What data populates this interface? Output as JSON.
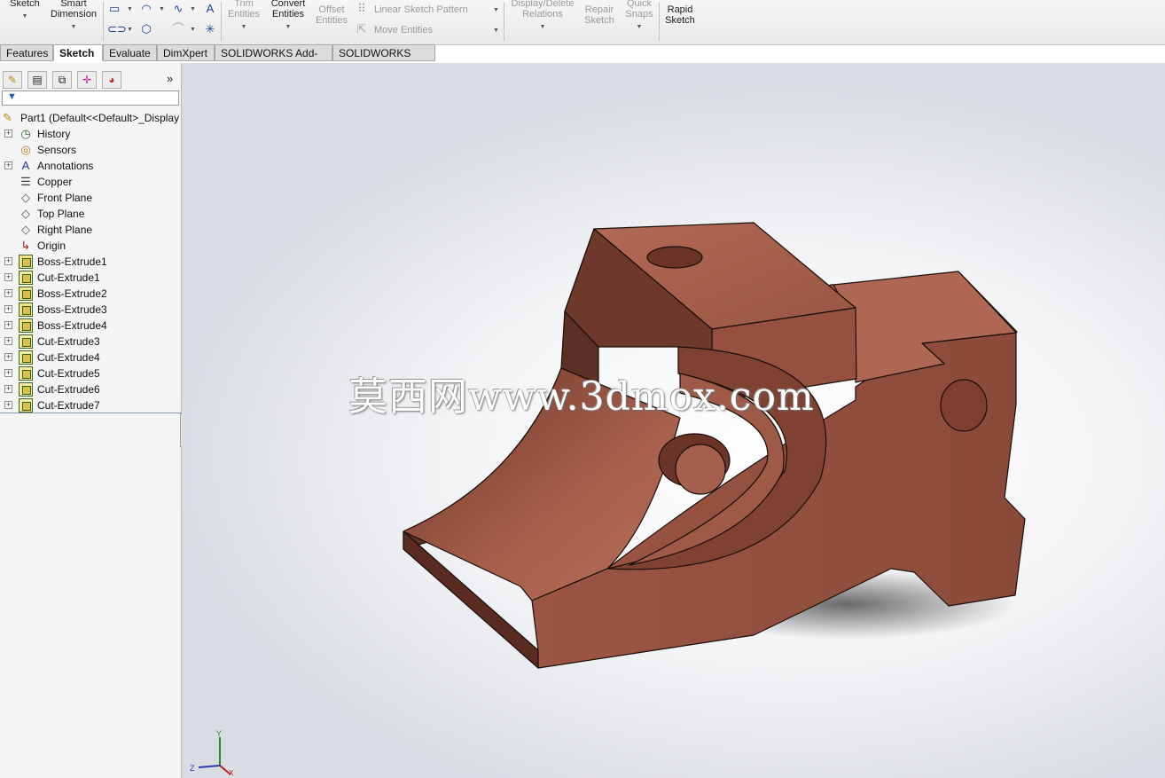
{
  "ribbon": {
    "sketch_label": "Sketch",
    "smart_dimension_label": "Smart\nDimension",
    "trim_entities_label": "Trim\nEntities",
    "convert_entities_label": "Convert\nEntities",
    "offset_entities_label": "Offset\nEntities",
    "linear_sketch_pattern_label": "Linear Sketch Pattern",
    "move_entities_label": "Move Entities",
    "display_delete_relations_label": "Display/Delete\nRelations",
    "repair_sketch_label": "Repair\nSketch",
    "quick_snaps_label": "Quick\nSnaps",
    "rapid_sketch_label": "Rapid\nSketch"
  },
  "tabs": [
    "Features",
    "Sketch",
    "Evaluate",
    "DimXpert",
    "SOLIDWORKS Add-Ins",
    "SOLIDWORKS MBD"
  ],
  "active_tab": "Sketch",
  "feature_tree": {
    "root": "Part1  (Default<<Default>_Display",
    "items": [
      {
        "label": "History",
        "icon": "history-icon",
        "expandable": true
      },
      {
        "label": "Sensors",
        "icon": "sensors-icon",
        "expandable": false
      },
      {
        "label": "Annotations",
        "icon": "annotations-icon",
        "expandable": true
      },
      {
        "label": "Copper",
        "icon": "material-icon",
        "expandable": false
      },
      {
        "label": "Front Plane",
        "icon": "plane-icon",
        "expandable": false
      },
      {
        "label": "Top Plane",
        "icon": "plane-icon",
        "expandable": false
      },
      {
        "label": "Right Plane",
        "icon": "plane-icon",
        "expandable": false
      },
      {
        "label": "Origin",
        "icon": "origin-icon",
        "expandable": false
      },
      {
        "label": "Boss-Extrude1",
        "icon": "boss-extrude-icon",
        "expandable": true
      },
      {
        "label": "Cut-Extrude1",
        "icon": "cut-extrude-icon",
        "expandable": true
      },
      {
        "label": "Boss-Extrude2",
        "icon": "boss-extrude-icon",
        "expandable": true
      },
      {
        "label": "Boss-Extrude3",
        "icon": "boss-extrude-icon",
        "expandable": true
      },
      {
        "label": "Boss-Extrude4",
        "icon": "boss-extrude-icon",
        "expandable": true
      },
      {
        "label": "Cut-Extrude3",
        "icon": "cut-extrude-icon",
        "expandable": true
      },
      {
        "label": "Cut-Extrude4",
        "icon": "cut-extrude-icon",
        "expandable": true
      },
      {
        "label": "Cut-Extrude5",
        "icon": "cut-extrude-icon",
        "expandable": true
      },
      {
        "label": "Cut-Extrude6",
        "icon": "cut-extrude-icon",
        "expandable": true
      },
      {
        "label": "Cut-Extrude7",
        "icon": "cut-extrude-icon",
        "expandable": true
      }
    ]
  },
  "viewport": {
    "watermark": "莫西网www.3dmox.com",
    "axis_labels": {
      "x": "X",
      "y": "Y",
      "z": "Z"
    },
    "part_color": "#9e5a47"
  },
  "colors": {
    "accent": "#1f3f9a",
    "copper": "#9e5a47"
  }
}
